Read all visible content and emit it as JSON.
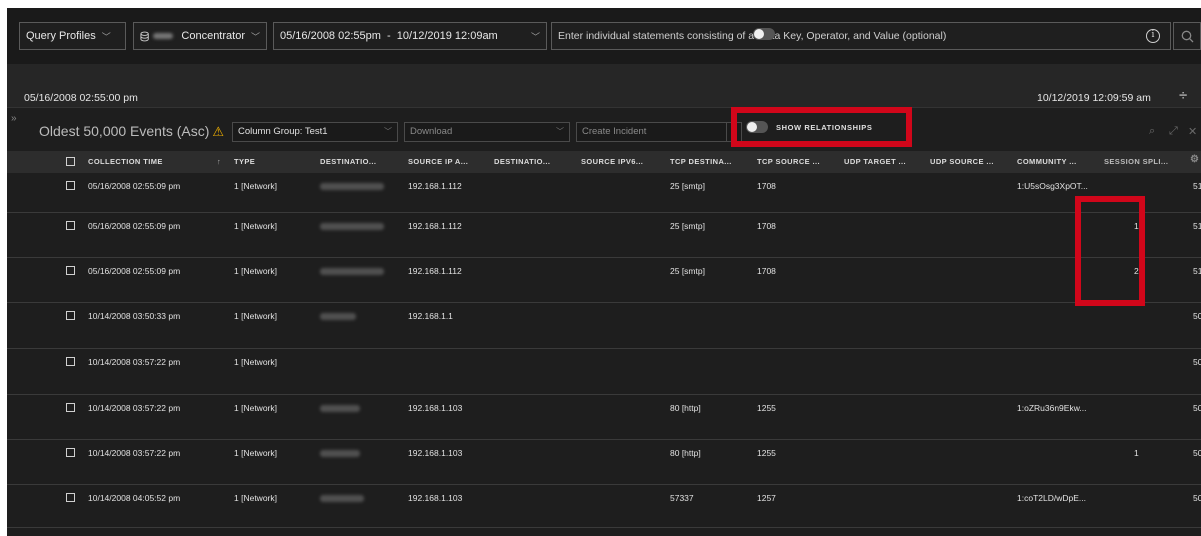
{
  "query_bar": {
    "profiles_label": "Query Profiles",
    "service_label": "Concentrator",
    "time_range": "05/16/2008 02:55pm  -  10/12/2019 12:09am",
    "query_placeholder": "Enter individual statements consisting of a Meta Key, Operator, and Value (optional)",
    "info_glyph": "i",
    "search_icon": "search-icon"
  },
  "timeline": {
    "start": "05/16/2008 02:55:00 pm",
    "end": "10/12/2019 12:09:59 am",
    "expand_glyph": "»",
    "adjust_glyph": "÷"
  },
  "events": {
    "title": "Oldest 50,000 Events (Asc)",
    "warn_glyph": "⚠",
    "column_group": "Column Group: Test1",
    "download": "Download",
    "create_incident": "Create Incident",
    "show_relationships": "SHOW RELATIONSHIPS",
    "search_glyph": "⌕",
    "expand_glyph": "⤢",
    "close_glyph": "✕"
  },
  "columns": {
    "collection_time": "COLLECTION TIME",
    "sort_glyph": "↑",
    "type": "TYPE",
    "destination1": "DESTINATIO...",
    "source_ip": "SOURCE IP A...",
    "destination2": "DESTINATIO...",
    "source_ipv6": "SOURCE IPV6...",
    "tcp_dest": "TCP DESTINA...",
    "tcp_source": "TCP SOURCE ...",
    "udp_target": "UDP TARGET ...",
    "udp_source": "UDP SOURCE ...",
    "community": "COMMUNITY ...",
    "session_split": "SESSION SPLI...",
    "settings_glyph": "⚙"
  },
  "rows": [
    {
      "time": "05/16/2008 02:55:09 pm",
      "type": "1 [Network]",
      "source_ip": "192.168.1.112",
      "tcp_dest": "25 [smtp]",
      "tcp_source": "1708",
      "community": "1:U5sOsg3XpOT...",
      "session_split": "",
      "last": "51"
    },
    {
      "time": "05/16/2008 02:55:09 pm",
      "type": "1 [Network]",
      "source_ip": "192.168.1.112",
      "tcp_dest": "25 [smtp]",
      "tcp_source": "1708",
      "community": "",
      "session_split": "1",
      "last": "51"
    },
    {
      "time": "05/16/2008 02:55:09 pm",
      "type": "1 [Network]",
      "source_ip": "192.168.1.112",
      "tcp_dest": "25 [smtp]",
      "tcp_source": "1708",
      "community": "",
      "session_split": "2",
      "last": "51"
    },
    {
      "time": "10/14/2008 03:50:33 pm",
      "type": "1 [Network]",
      "source_ip": "192.168.1.1",
      "tcp_dest": "",
      "tcp_source": "",
      "community": "",
      "session_split": "",
      "last": "50"
    },
    {
      "time": "10/14/2008 03:57:22 pm",
      "type": "1 [Network]",
      "source_ip": "",
      "tcp_dest": "",
      "tcp_source": "",
      "community": "",
      "session_split": "",
      "last": "50"
    },
    {
      "time": "10/14/2008 03:57:22 pm",
      "type": "1 [Network]",
      "source_ip": "192.168.1.103",
      "tcp_dest": "80 [http]",
      "tcp_source": "1255",
      "community": "1:oZRu36n9Ekw...",
      "session_split": "",
      "last": "50"
    },
    {
      "time": "10/14/2008 03:57:22 pm",
      "type": "1 [Network]",
      "source_ip": "192.168.1.103",
      "tcp_dest": "80 [http]",
      "tcp_source": "1255",
      "community": "",
      "session_split": "1",
      "last": "50"
    },
    {
      "time": "10/14/2008 04:05:52 pm",
      "type": "1 [Network]",
      "source_ip": "192.168.1.103",
      "tcp_dest": "57337",
      "tcp_source": "1257",
      "community": "1:coT2LD/wDpE...",
      "session_split": "",
      "last": "50"
    }
  ],
  "colors": {
    "background": "#1e1e1e",
    "header": "#2d2d2d",
    "annotation": "#d1061a",
    "warning": "#f0b000"
  }
}
